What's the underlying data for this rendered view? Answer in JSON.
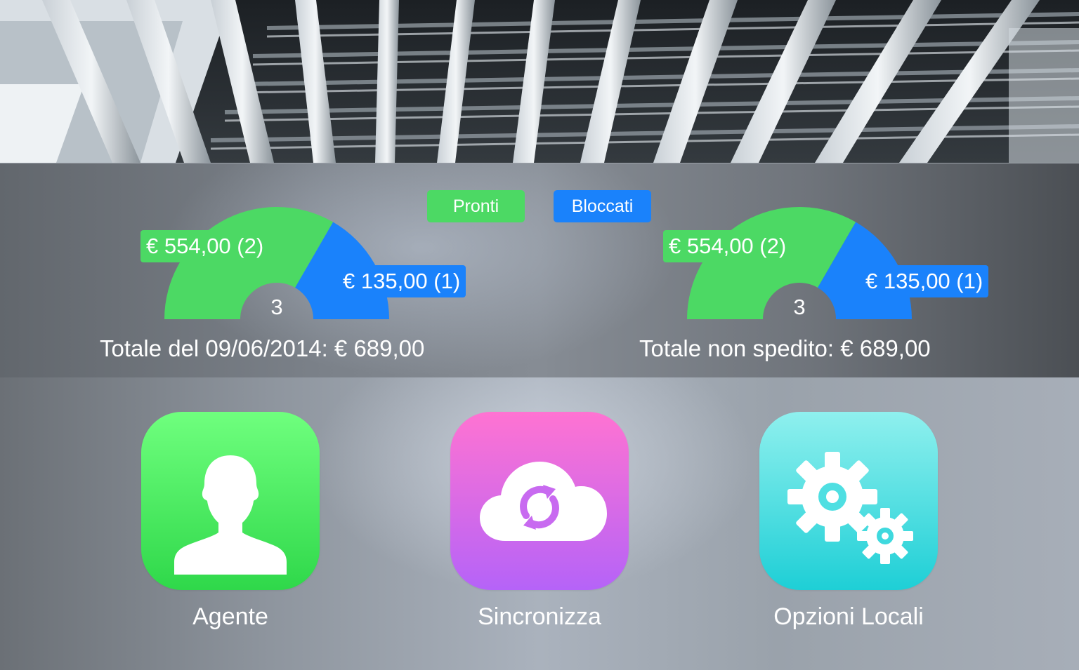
{
  "legend": {
    "ready_label": "Pronti",
    "blocked_label": "Bloccati"
  },
  "colors": {
    "ready": "#4cd964",
    "blocked": "#1a82fb",
    "agent_icon": "#4cd964",
    "sync_icon": "#c86af0",
    "local_options_icon": "#2fd3da"
  },
  "gauges": [
    {
      "ready_amount": "€ 554,00 (2)",
      "blocked_amount": "€ 135,00 (1)",
      "count": "3",
      "ready_fraction": 0.667,
      "total_text": "Totale del 09/06/2014: € 689,00"
    },
    {
      "ready_amount": "€ 554,00 (2)",
      "blocked_amount": "€ 135,00 (1)",
      "count": "3",
      "ready_fraction": 0.667,
      "total_text": "Totale non spedito: € 689,00"
    }
  ],
  "apps": [
    {
      "label": "Agente",
      "icon": "person-silhouette-icon"
    },
    {
      "label": "Sincronizza",
      "icon": "cloud-sync-icon"
    },
    {
      "label": "Opzioni Locali",
      "icon": "gears-icon"
    }
  ]
}
